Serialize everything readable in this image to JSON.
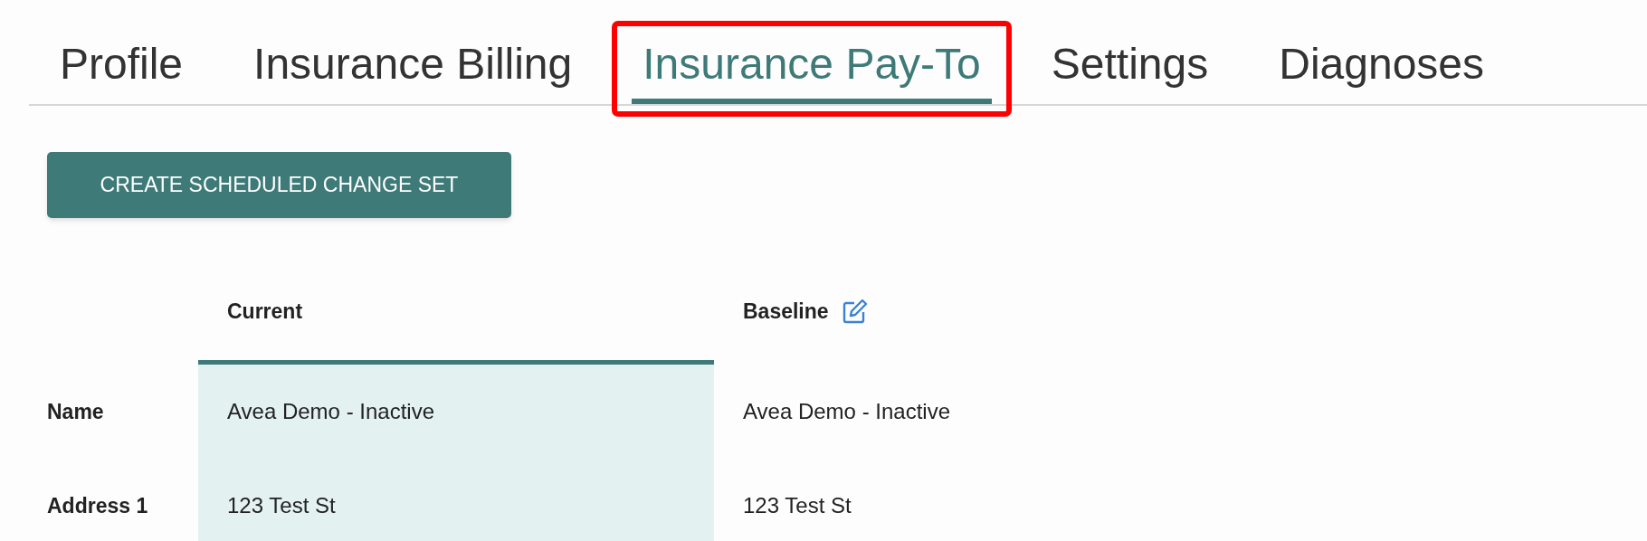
{
  "tabs": [
    {
      "label": "Profile",
      "selected": false,
      "highlighted": false
    },
    {
      "label": "Insurance Billing",
      "selected": false,
      "highlighted": false
    },
    {
      "label": "Insurance Pay-To",
      "selected": true,
      "highlighted": true
    },
    {
      "label": "Settings",
      "selected": false,
      "highlighted": false
    },
    {
      "label": "Diagnoses",
      "selected": false,
      "highlighted": false
    }
  ],
  "action_button": "CREATE SCHEDULED CHANGE SET",
  "table": {
    "columns": [
      {
        "label": "Current",
        "selected": true,
        "editable": false
      },
      {
        "label": "Baseline",
        "selected": false,
        "editable": true
      }
    ],
    "rows": [
      {
        "label": "Name",
        "cells": [
          "Avea Demo - Inactive",
          "Avea Demo - Inactive"
        ]
      },
      {
        "label": "Address 1",
        "cells": [
          "123 Test St",
          "123 Test St"
        ]
      }
    ]
  }
}
